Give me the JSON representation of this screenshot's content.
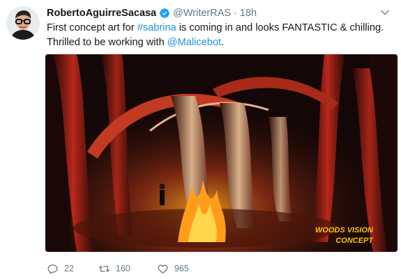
{
  "tweet": {
    "author": {
      "display_name": "RobertoAguirreSacasa",
      "handle": "@WriterRAS",
      "verified": true,
      "avatar_icon": "profile-photo"
    },
    "separator": "·",
    "timestamp": "18h",
    "text_parts": {
      "part1": "First concept art for ",
      "hashtag": "#sabrina",
      "part2": " is coming in and looks FANTASTIC & chilling.",
      "line2": "Thrilled to be working with ",
      "mention": "@Malicebot",
      "end": "."
    },
    "media": {
      "caption_line1": "WOODS VISION",
      "caption_line2": "CONCEPT"
    },
    "actions": {
      "replies": "22",
      "retweets": "160",
      "likes": "965"
    }
  },
  "colors": {
    "link": "#1b95e0",
    "muted": "#657786",
    "verified": "#1da1f2",
    "caption": "#f5c400"
  }
}
